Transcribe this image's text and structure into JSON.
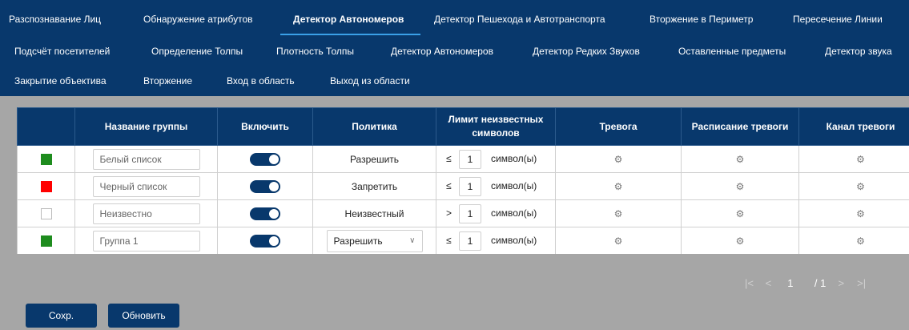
{
  "tabs": [
    "Разспознавание Лиц",
    "Обнаружение атрибутов",
    "Детектор Автономеров",
    "Детектор Пешехода и Автотранспорта",
    "Вторжение в Периметр",
    "Пересечение Линии",
    "Подсчёт посетителей",
    "Определение Толпы",
    "Плотность Толпы",
    "Детектор Автономеров",
    "Детектор Редких Звуков",
    "Оставленные предметы",
    "Детектор звука",
    "Закрытие объектива",
    "Вторжение",
    "Вход в область",
    "Выход из области"
  ],
  "active_tab_index": 2,
  "table": {
    "headers": {
      "group_name": "Название группы",
      "enable": "Включить",
      "policy": "Политика",
      "limit": "Лимит неизвестных символов",
      "alarm": "Тревога",
      "alarm_schedule": "Расписание тревоги",
      "alarm_channel": "Канал тревоги"
    },
    "rows": [
      {
        "color": "#1e8c1e",
        "name": "Белый список",
        "enabled": true,
        "policy": "Разрешить",
        "policy_is_select": false,
        "limit_op": "≤",
        "limit_value": "1",
        "unit": "символ(ы)"
      },
      {
        "color": "#ff0000",
        "name": "Черный список",
        "enabled": true,
        "policy": "Запретить",
        "policy_is_select": false,
        "limit_op": "≤",
        "limit_value": "1",
        "unit": "символ(ы)"
      },
      {
        "color": "#ffffff",
        "name": "Неизвестно",
        "enabled": true,
        "policy": "Неизвестный",
        "policy_is_select": false,
        "limit_op": ">",
        "limit_value": "1",
        "unit": "символ(ы)"
      },
      {
        "color": "#1e8c1e",
        "name": "Группа 1",
        "enabled": true,
        "policy": "Разрешить",
        "policy_is_select": true,
        "limit_op": "≤",
        "limit_value": "1",
        "unit": "символ(ы)"
      }
    ],
    "gear_icon": "⚙"
  },
  "pagination": {
    "first_icon": "|<",
    "prev_icon": "<",
    "current": "1",
    "total": "/ 1",
    "next_icon": ">",
    "last_icon": ">|"
  },
  "buttons": {
    "save": "Сохр.",
    "refresh": "Обновить"
  },
  "colors": {
    "primary": "#08386c",
    "accent": "#3aa0e8",
    "background": "#a6a6a6"
  }
}
